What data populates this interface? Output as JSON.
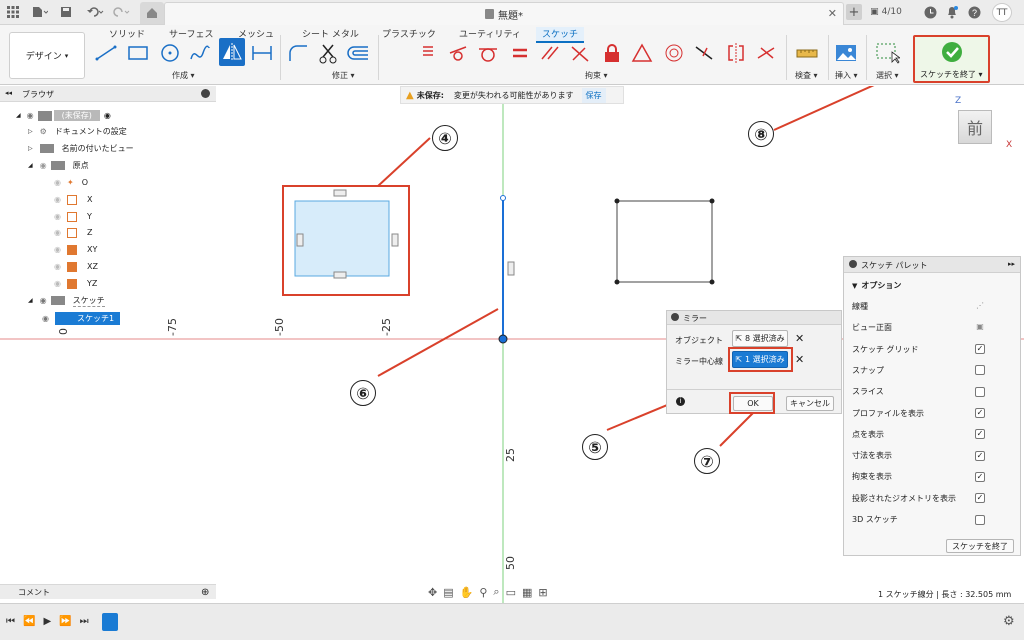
{
  "titlebar": {
    "doc_title": "無題*",
    "version": "4/10",
    "user": "TT"
  },
  "ribbon": {
    "tabs": [
      "ソリッド",
      "サーフェス",
      "メッシュ",
      "シート メタル",
      "プラスチック",
      "ユーティリティ",
      "スケッチ"
    ],
    "design_label": "デザイン",
    "groups": {
      "create": "作成",
      "modify": "修正",
      "constrain": "拘束",
      "inspect": "検査",
      "insert": "挿入",
      "select": "選択"
    },
    "finish_label": "スケッチを終了"
  },
  "browser": {
    "title": "ブラウザ",
    "items": [
      {
        "label": "(未保存)"
      },
      {
        "label": "ドキュメントの設定"
      },
      {
        "label": "名前の付いたビュー"
      },
      {
        "label": "原点"
      },
      {
        "label": "O"
      },
      {
        "label": "X"
      },
      {
        "label": "Y"
      },
      {
        "label": "Z"
      },
      {
        "label": "XY"
      },
      {
        "label": "XZ"
      },
      {
        "label": "YZ"
      },
      {
        "label": "スケッチ"
      },
      {
        "label": "スケッチ1"
      }
    ]
  },
  "banner": {
    "label": "未保存:",
    "message": "変更が失われる可能性があります",
    "save": "保存"
  },
  "axis_labels": {
    "m75": "-75",
    "m50": "-50",
    "m25": "-25",
    "p25": "25",
    "p50": "50",
    "o": "0"
  },
  "mirror": {
    "title": "ミラー",
    "object_label": "オブジェクト",
    "object_value": "8 選択済み",
    "line_label": "ミラー中心線",
    "line_value": "1 選択済み",
    "ok": "OK",
    "cancel": "キャンセル"
  },
  "palette": {
    "title": "スケッチ パレット",
    "section": "オプション",
    "rows": [
      {
        "label": "線種",
        "checked": null
      },
      {
        "label": "ビュー正面",
        "checked": null
      },
      {
        "label": "スケッチ グリッド",
        "checked": true
      },
      {
        "label": "スナップ",
        "checked": false
      },
      {
        "label": "スライス",
        "checked": false
      },
      {
        "label": "プロファイルを表示",
        "checked": true
      },
      {
        "label": "点を表示",
        "checked": true
      },
      {
        "label": "寸法を表示",
        "checked": true
      },
      {
        "label": "拘束を表示",
        "checked": true
      },
      {
        "label": "投影されたジオメトリを表示",
        "checked": true
      },
      {
        "label": "3D スケッチ",
        "checked": false
      }
    ],
    "finish": "スケッチを終了"
  },
  "viewcube": {
    "face": "前",
    "z": "Z",
    "x": "X"
  },
  "status": {
    "text": "1 スケッチ線分 | 長さ : 32.505 mm"
  },
  "comment": {
    "label": "コメント"
  },
  "callouts": {
    "c4": "④",
    "c5": "⑤",
    "c6": "⑥",
    "c7": "⑦",
    "c8": "⑧"
  },
  "colors": {
    "accent": "#0b6fc2",
    "callout": "#d9412b",
    "axis_green": "#7ed07e",
    "axis_red": "#e48a8a"
  }
}
